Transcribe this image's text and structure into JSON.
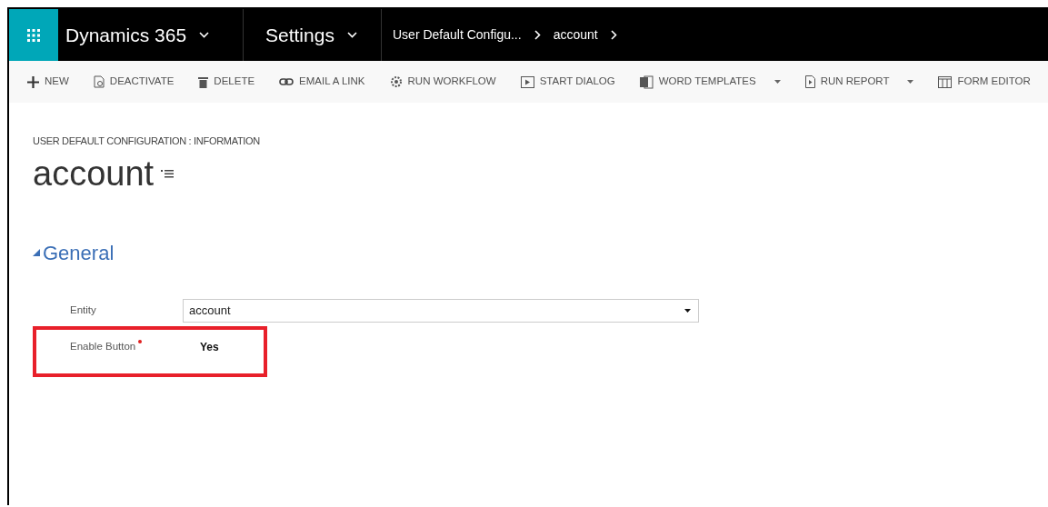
{
  "nav": {
    "app_name": "Dynamics 365",
    "area": "Settings",
    "breadcrumbs": [
      "User Default Configu...",
      "account"
    ]
  },
  "toolbar": [
    {
      "kind": "new",
      "label": "NEW",
      "dropdown": false
    },
    {
      "kind": "deactivate",
      "label": "DEACTIVATE",
      "dropdown": false
    },
    {
      "kind": "delete",
      "label": "DELETE",
      "dropdown": false
    },
    {
      "kind": "link",
      "label": "EMAIL A LINK",
      "dropdown": false
    },
    {
      "kind": "workflow",
      "label": "RUN WORKFLOW",
      "dropdown": false
    },
    {
      "kind": "dialog",
      "label": "START DIALOG",
      "dropdown": false
    },
    {
      "kind": "word",
      "label": "WORD TEMPLATES",
      "dropdown": true
    },
    {
      "kind": "report",
      "label": "RUN REPORT",
      "dropdown": true
    },
    {
      "kind": "form",
      "label": "FORM EDITOR",
      "dropdown": false
    }
  ],
  "record": {
    "entity_caption": "USER DEFAULT CONFIGURATION : INFORMATION",
    "title": "account"
  },
  "section": {
    "title": "General",
    "expanded": true
  },
  "fields": [
    {
      "kind": "select",
      "label": "Entity",
      "value": "account",
      "required": false,
      "highlighted": false
    },
    {
      "kind": "text",
      "label": "Enable Button",
      "value": "Yes",
      "required": true,
      "highlighted": true
    }
  ]
}
